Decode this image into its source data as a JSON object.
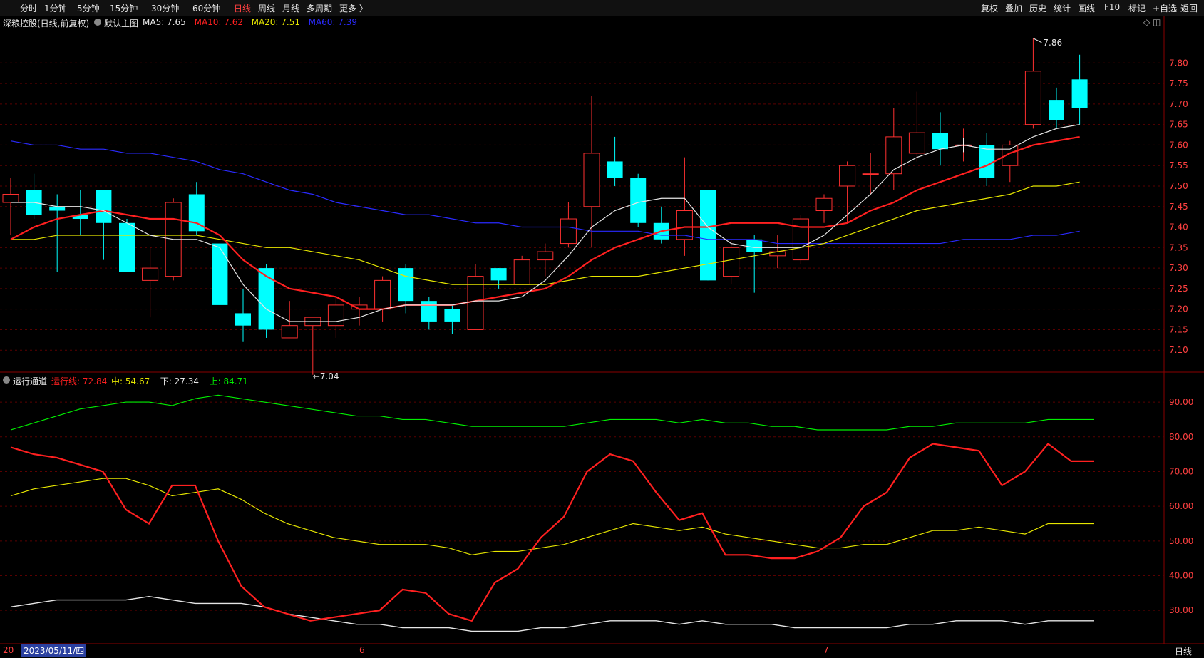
{
  "toolbar": {
    "periods": [
      {
        "label": "分时",
        "active": false
      },
      {
        "label": "1分钟",
        "active": false
      },
      {
        "label": "5分钟",
        "active": false
      },
      {
        "label": "15分钟",
        "active": false
      },
      {
        "label": "30分钟",
        "active": false
      },
      {
        "label": "60分钟",
        "active": false
      },
      {
        "label": "日线",
        "active": true
      },
      {
        "label": "周线",
        "active": false
      },
      {
        "label": "月线",
        "active": false
      },
      {
        "label": "多周期",
        "active": false
      },
      {
        "label": "更多 〉",
        "active": false
      }
    ],
    "right_buttons": [
      "复权",
      "叠加",
      "历史",
      "统计",
      "画线",
      "F10",
      "标记",
      "+自选",
      "返回"
    ]
  },
  "main_caption": {
    "stock": "深粮控股(日线,前复权)",
    "indicator": "默认主图",
    "ma": [
      {
        "label": "MA5: 7.65",
        "color": "#e6e6e6"
      },
      {
        "label": "MA10: 7.62",
        "color": "#ff2020"
      },
      {
        "label": "MA20: 7.51",
        "color": "#e6e600"
      },
      {
        "label": "MA60: 7.39",
        "color": "#2a2aff"
      }
    ]
  },
  "sub_caption": {
    "indicator": "运行通道",
    "values": [
      {
        "label": "运行线: 72.84",
        "color": "#ff2020"
      },
      {
        "label": "中: 54.67",
        "color": "#e6e600"
      },
      {
        "label": "下: 27.34",
        "color": "#e6e6e6"
      },
      {
        "label": "上: 84.71",
        "color": "#00ee00"
      }
    ]
  },
  "price_axis": [
    "7.80",
    "7.75",
    "7.70",
    "7.65",
    "7.60",
    "7.55",
    "7.50",
    "7.45",
    "7.40",
    "7.35",
    "7.30",
    "7.25",
    "7.20",
    "7.15",
    "7.10"
  ],
  "sub_axis": [
    "90.00",
    "80.00",
    "70.00",
    "60.00",
    "50.00",
    "40.00",
    "30.00"
  ],
  "annotations": {
    "high": "7.86",
    "low": "7.04"
  },
  "date_axis": {
    "start_prefix": "20",
    "cursor_date": "2023/05/11/四",
    "month_6": "6",
    "month_7": "7",
    "period_tab": "日线"
  },
  "colors": {
    "up": "#ff3030",
    "down": "#00ffff",
    "grid": "#5a0000",
    "axis_text": "#ff4040"
  },
  "chart_data": {
    "type": "candlestick",
    "series_candles": [
      {
        "o": 7.46,
        "h": 7.52,
        "l": 7.38,
        "c": 7.48
      },
      {
        "o": 7.49,
        "h": 7.53,
        "l": 7.42,
        "c": 7.43
      },
      {
        "o": 7.45,
        "h": 7.48,
        "l": 7.29,
        "c": 7.44
      },
      {
        "o": 7.43,
        "h": 7.49,
        "l": 7.38,
        "c": 7.42
      },
      {
        "o": 7.49,
        "h": 7.49,
        "l": 7.32,
        "c": 7.41
      },
      {
        "o": 7.41,
        "h": 7.42,
        "l": 7.29,
        "c": 7.29
      },
      {
        "o": 7.27,
        "h": 7.35,
        "l": 7.18,
        "c": 7.3
      },
      {
        "o": 7.28,
        "h": 7.47,
        "l": 7.27,
        "c": 7.46
      },
      {
        "o": 7.48,
        "h": 7.51,
        "l": 7.38,
        "c": 7.39
      },
      {
        "o": 7.36,
        "h": 7.36,
        "l": 7.21,
        "c": 7.21
      },
      {
        "o": 7.19,
        "h": 7.25,
        "l": 7.12,
        "c": 7.16
      },
      {
        "o": 7.3,
        "h": 7.31,
        "l": 7.13,
        "c": 7.15
      },
      {
        "o": 7.13,
        "h": 7.22,
        "l": 7.13,
        "c": 7.16
      },
      {
        "o": 7.16,
        "h": 7.18,
        "l": 7.04,
        "c": 7.18
      },
      {
        "o": 7.16,
        "h": 7.23,
        "l": 7.13,
        "c": 7.21
      },
      {
        "o": 7.2,
        "h": 7.23,
        "l": 7.16,
        "c": 7.21
      },
      {
        "o": 7.2,
        "h": 7.28,
        "l": 7.17,
        "c": 7.27
      },
      {
        "o": 7.3,
        "h": 7.31,
        "l": 7.19,
        "c": 7.22
      },
      {
        "o": 7.22,
        "h": 7.23,
        "l": 7.15,
        "c": 7.17
      },
      {
        "o": 7.2,
        "h": 7.21,
        "l": 7.14,
        "c": 7.17
      },
      {
        "o": 7.15,
        "h": 7.31,
        "l": 7.15,
        "c": 7.28
      },
      {
        "o": 7.3,
        "h": 7.3,
        "l": 7.25,
        "c": 7.27
      },
      {
        "o": 7.26,
        "h": 7.33,
        "l": 7.26,
        "c": 7.32
      },
      {
        "o": 7.32,
        "h": 7.36,
        "l": 7.28,
        "c": 7.34
      },
      {
        "o": 7.36,
        "h": 7.46,
        "l": 7.35,
        "c": 7.42
      },
      {
        "o": 7.45,
        "h": 7.72,
        "l": 7.35,
        "c": 7.58
      },
      {
        "o": 7.56,
        "h": 7.62,
        "l": 7.5,
        "c": 7.52
      },
      {
        "o": 7.52,
        "h": 7.53,
        "l": 7.4,
        "c": 7.41
      },
      {
        "o": 7.41,
        "h": 7.45,
        "l": 7.36,
        "c": 7.37
      },
      {
        "o": 7.37,
        "h": 7.57,
        "l": 7.33,
        "c": 7.44
      },
      {
        "o": 7.49,
        "h": 7.49,
        "l": 7.27,
        "c": 7.27
      },
      {
        "o": 7.28,
        "h": 7.37,
        "l": 7.26,
        "c": 7.35
      },
      {
        "o": 7.37,
        "h": 7.38,
        "l": 7.24,
        "c": 7.34
      },
      {
        "o": 7.33,
        "h": 7.38,
        "l": 7.3,
        "c": 7.34
      },
      {
        "o": 7.32,
        "h": 7.43,
        "l": 7.31,
        "c": 7.42
      },
      {
        "o": 7.44,
        "h": 7.48,
        "l": 7.41,
        "c": 7.47
      },
      {
        "o": 7.5,
        "h": 7.56,
        "l": 7.41,
        "c": 7.55
      },
      {
        "o": 7.53,
        "h": 7.58,
        "l": 7.48,
        "c": 7.53
      },
      {
        "o": 7.53,
        "h": 7.69,
        "l": 7.49,
        "c": 7.62
      },
      {
        "o": 7.58,
        "h": 7.73,
        "l": 7.56,
        "c": 7.63
      },
      {
        "o": 7.63,
        "h": 7.68,
        "l": 7.55,
        "c": 7.59
      },
      {
        "o": 7.6,
        "h": 7.64,
        "l": 7.56,
        "c": 7.6
      },
      {
        "o": 7.6,
        "h": 7.63,
        "l": 7.5,
        "c": 7.52
      },
      {
        "o": 7.55,
        "h": 7.61,
        "l": 7.51,
        "c": 7.6
      },
      {
        "o": 7.65,
        "h": 7.86,
        "l": 7.64,
        "c": 7.78
      },
      {
        "o": 7.71,
        "h": 7.74,
        "l": 7.64,
        "c": 7.66
      },
      {
        "o": 7.76,
        "h": 7.82,
        "l": 7.65,
        "c": 7.69
      }
    ],
    "ma5": [
      7.46,
      7.46,
      7.45,
      7.45,
      7.44,
      7.41,
      7.38,
      7.37,
      7.37,
      7.35,
      7.26,
      7.2,
      7.17,
      7.17,
      7.17,
      7.18,
      7.2,
      7.21,
      7.21,
      7.21,
      7.22,
      7.22,
      7.23,
      7.27,
      7.33,
      7.4,
      7.44,
      7.46,
      7.47,
      7.47,
      7.4,
      7.36,
      7.35,
      7.35,
      7.35,
      7.38,
      7.43,
      7.48,
      7.54,
      7.57,
      7.59,
      7.6,
      7.59,
      7.59,
      7.62,
      7.64,
      7.65
    ],
    "ma10": [
      7.37,
      7.4,
      7.42,
      7.43,
      7.44,
      7.43,
      7.42,
      7.42,
      7.41,
      7.38,
      7.32,
      7.28,
      7.25,
      7.24,
      7.23,
      7.2,
      7.2,
      7.21,
      7.21,
      7.21,
      7.22,
      7.23,
      7.24,
      7.25,
      7.28,
      7.32,
      7.35,
      7.37,
      7.39,
      7.4,
      7.4,
      7.41,
      7.41,
      7.41,
      7.4,
      7.4,
      7.41,
      7.44,
      7.46,
      7.49,
      7.51,
      7.53,
      7.55,
      7.58,
      7.6,
      7.61,
      7.62
    ],
    "ma20": [
      7.37,
      7.37,
      7.38,
      7.38,
      7.38,
      7.38,
      7.38,
      7.38,
      7.38,
      7.37,
      7.36,
      7.35,
      7.35,
      7.34,
      7.33,
      7.32,
      7.3,
      7.28,
      7.27,
      7.26,
      7.26,
      7.26,
      7.26,
      7.26,
      7.27,
      7.28,
      7.28,
      7.28,
      7.29,
      7.3,
      7.31,
      7.32,
      7.33,
      7.34,
      7.35,
      7.36,
      7.38,
      7.4,
      7.42,
      7.44,
      7.45,
      7.46,
      7.47,
      7.48,
      7.5,
      7.5,
      7.51
    ],
    "ma60": [
      7.61,
      7.6,
      7.6,
      7.59,
      7.59,
      7.58,
      7.58,
      7.57,
      7.56,
      7.54,
      7.53,
      7.51,
      7.49,
      7.48,
      7.46,
      7.45,
      7.44,
      7.43,
      7.43,
      7.42,
      7.41,
      7.41,
      7.4,
      7.4,
      7.4,
      7.39,
      7.39,
      7.39,
      7.38,
      7.38,
      7.37,
      7.37,
      7.37,
      7.36,
      7.36,
      7.36,
      7.36,
      7.36,
      7.36,
      7.36,
      7.36,
      7.37,
      7.37,
      7.37,
      7.38,
      7.38,
      7.39
    ],
    "ylim": [
      7.05,
      7.87
    ],
    "sub_run": [
      77,
      75,
      74,
      72,
      70,
      59,
      55,
      66,
      66,
      50,
      37,
      31,
      29,
      27,
      28,
      29,
      30,
      36,
      35,
      29,
      27,
      38,
      42,
      51,
      57,
      70,
      75,
      73,
      64,
      56,
      58,
      46,
      46,
      45,
      45,
      47,
      51,
      60,
      64,
      74,
      78,
      77,
      76,
      66,
      70,
      78,
      73,
      73
    ],
    "sub_mid": [
      63,
      65,
      66,
      67,
      68,
      68,
      66,
      63,
      64,
      65,
      62,
      58,
      55,
      53,
      51,
      50,
      49,
      49,
      49,
      48,
      46,
      47,
      47,
      48,
      49,
      51,
      53,
      55,
      54,
      53,
      54,
      52,
      51,
      50,
      49,
      48,
      48,
      49,
      49,
      51,
      53,
      53,
      54,
      53,
      52,
      55,
      55,
      55
    ],
    "sub_low": [
      31,
      32,
      33,
      33,
      33,
      33,
      34,
      33,
      32,
      32,
      32,
      31,
      29,
      28,
      27,
      26,
      26,
      25,
      25,
      25,
      24,
      24,
      24,
      25,
      25,
      26,
      27,
      27,
      27,
      26,
      27,
      26,
      26,
      26,
      25,
      25,
      25,
      25,
      25,
      26,
      26,
      27,
      27,
      27,
      26,
      27,
      27,
      27
    ],
    "sub_up": [
      82,
      84,
      86,
      88,
      89,
      90,
      90,
      89,
      91,
      92,
      91,
      90,
      89,
      88,
      87,
      86,
      86,
      85,
      85,
      84,
      83,
      83,
      83,
      83,
      83,
      84,
      85,
      85,
      85,
      84,
      85,
      84,
      84,
      83,
      83,
      82,
      82,
      82,
      82,
      83,
      83,
      84,
      84,
      84,
      84,
      85,
      85,
      85
    ],
    "sub_ylim": [
      21,
      97
    ]
  }
}
